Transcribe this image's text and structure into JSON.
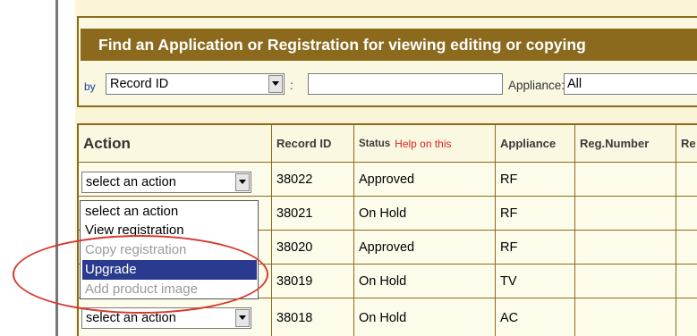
{
  "search": {
    "title": "Find an Application or Registration for viewing editing or copying",
    "by_label": "by",
    "by_select_value": "Record ID",
    "separator": ":",
    "search_value": "",
    "appliance_label": "Appliance:",
    "appliance_select_value": "All"
  },
  "table": {
    "headers": {
      "action": "Action",
      "record_id": "Record ID",
      "status": "Status",
      "status_help": "Help on this",
      "appliance": "Appliance",
      "reg_number": "Reg.Number",
      "more": "Re"
    },
    "rows": [
      {
        "action": "select an action",
        "record_id": "38022",
        "status": "Approved",
        "appliance": "RF",
        "reg_number": ""
      },
      {
        "action": "",
        "record_id": "38021",
        "status": "On Hold",
        "appliance": "RF",
        "reg_number": ""
      },
      {
        "action": "",
        "record_id": "38020",
        "status": "Approved",
        "appliance": "RF",
        "reg_number": ""
      },
      {
        "action": "",
        "record_id": "38019",
        "status": "On Hold",
        "appliance": "TV",
        "reg_number": ""
      },
      {
        "action": "select an action",
        "record_id": "38018",
        "status": "On Hold",
        "appliance": "AC",
        "reg_number": ""
      }
    ]
  },
  "action_dropdown": {
    "options": [
      {
        "label": "select an action",
        "state": "normal"
      },
      {
        "label": "View registration",
        "state": "normal"
      },
      {
        "label": "Copy registration",
        "state": "disabled"
      },
      {
        "label": "Upgrade",
        "state": "selected"
      },
      {
        "label": "Add product image",
        "state": "disabled"
      }
    ]
  },
  "colors": {
    "header_bg": "#8c6a1d",
    "panel_bg": "#f9f5d6",
    "selected_bg": "#2a3b8f",
    "help_text": "#dd2222",
    "annotation": "#d63a2e"
  }
}
